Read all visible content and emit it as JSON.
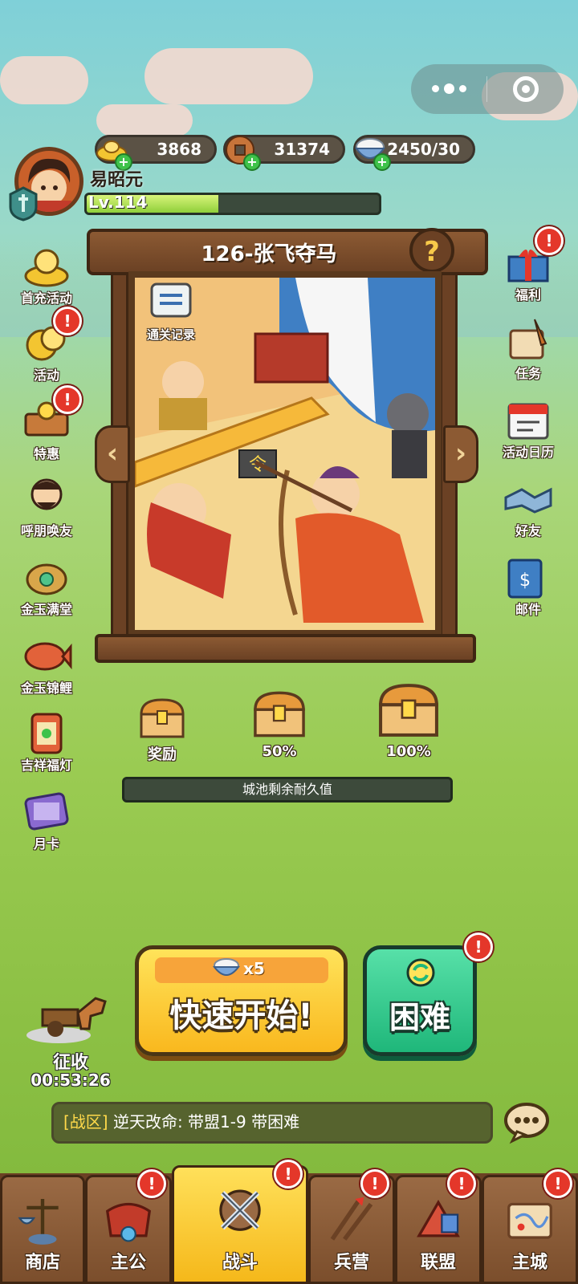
{
  "resources": [
    {
      "name": "gold-ingot",
      "value": "3868"
    },
    {
      "name": "copper-coin",
      "value": "31374"
    },
    {
      "name": "rice-bowl",
      "value": "2450/30"
    }
  ],
  "player": {
    "name": "易昭元",
    "level": "Lv.114",
    "exp_fraction": 0.45
  },
  "left_menu": [
    {
      "label": "首充活动",
      "icon": "gold-pile-icon",
      "alert": false
    },
    {
      "label": "活动",
      "icon": "gold-coins-icon",
      "alert": true
    },
    {
      "label": "特惠",
      "icon": "treasure-cart-icon",
      "alert": true
    },
    {
      "label": "呼朋唤友",
      "icon": "friends-general-icon",
      "alert": false
    },
    {
      "label": "金玉满堂",
      "icon": "jade-frog-icon",
      "alert": false
    },
    {
      "label": "金玉锦鲤",
      "icon": "koi-fish-icon",
      "alert": false
    },
    {
      "label": "吉祥福灯",
      "icon": "lantern-icon",
      "alert": false
    },
    {
      "label": "月卡",
      "icon": "month-card-icon",
      "alert": false
    }
  ],
  "right_menu": [
    {
      "label": "福利",
      "icon": "gift-box-icon",
      "alert": true
    },
    {
      "label": "任务",
      "icon": "scroll-quill-icon",
      "alert": false
    },
    {
      "label": "活动日历",
      "icon": "calendar-icon",
      "alert": false
    },
    {
      "label": "好友",
      "icon": "handshake-icon",
      "alert": false
    },
    {
      "label": "邮件",
      "icon": "mail-icon",
      "alert": false
    }
  ],
  "stage": {
    "title": "126-张飞夺马",
    "help": "?",
    "record_label": "通关记录",
    "flag_text": "令"
  },
  "rewards": [
    {
      "label": "奖励"
    },
    {
      "label": "50%"
    },
    {
      "label": "100%"
    }
  ],
  "durability_label": "城池剩余耐久值",
  "quick_start": {
    "cost": "x5",
    "label": "快速开始!"
  },
  "hard": {
    "label": "困难"
  },
  "collect": {
    "label": "征收",
    "timer": "00:53:26"
  },
  "chat": {
    "tag": "[战区]",
    "text": " 逆天改命: 带盟1-9  带困难"
  },
  "tabs": [
    {
      "label": "商店",
      "icon": "scale-icon",
      "alert": false
    },
    {
      "label": "主公",
      "icon": "armor-icon",
      "alert": true
    },
    {
      "label": "战斗",
      "icon": "crossed-swords-icon",
      "alert": true,
      "active": true
    },
    {
      "label": "兵营",
      "icon": "weapons-rack-icon",
      "alert": true
    },
    {
      "label": "联盟",
      "icon": "banner-tent-icon",
      "alert": true
    },
    {
      "label": "主城",
      "icon": "map-scroll-icon",
      "alert": true
    }
  ],
  "colors": {
    "accent_yellow": "#f9b81e",
    "hard_green": "#1fb77a",
    "wood": "#6b4124",
    "alert_red": "#e4372a"
  }
}
